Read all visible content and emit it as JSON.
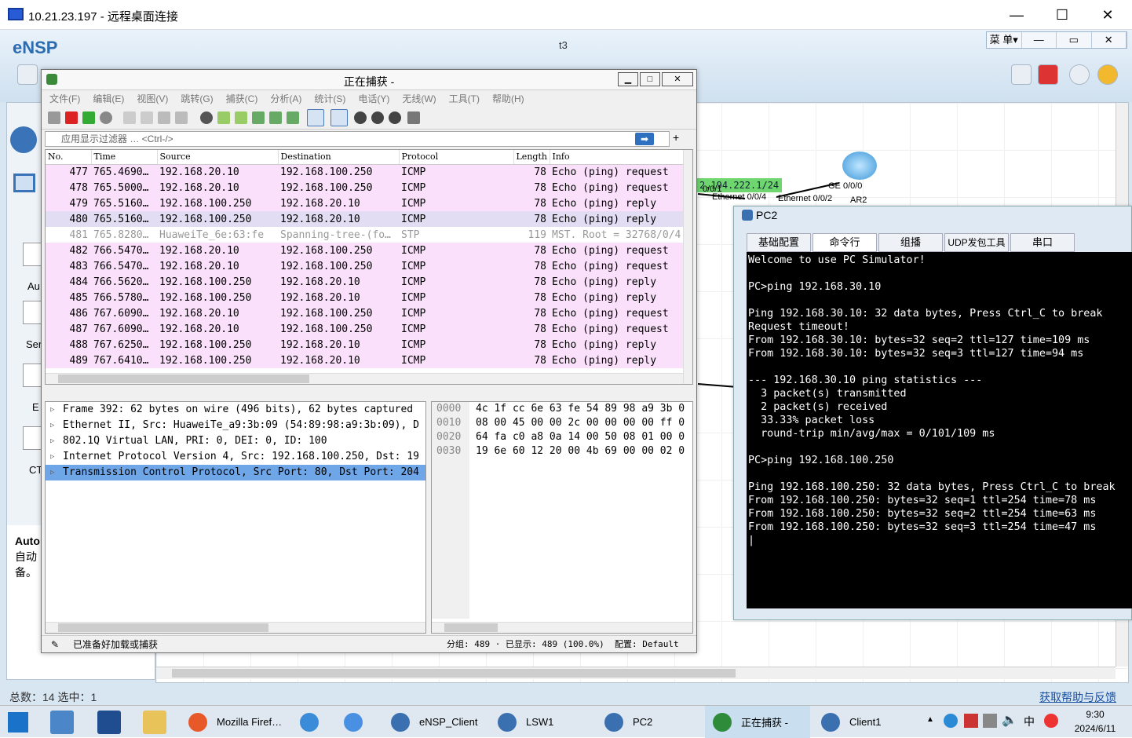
{
  "rdp": {
    "title": "10.21.23.197 - 远程桌面连接",
    "minimize": "—",
    "maximize": "☐",
    "close": "✕"
  },
  "ensp": {
    "logo": "eNSP",
    "title": "t3",
    "menu": [
      "菜 单▾",
      "—",
      "▭",
      "✕"
    ],
    "left_labels": [
      "Au",
      "Ser",
      "E",
      "CT"
    ],
    "auto_title": "Auto",
    "auto_desc": "自动 备。",
    "status_left": "总数：14  选中：1",
    "status_right": "获取帮助与反馈",
    "canvas_labels": {
      "ip": "2.194.222.1/24",
      "eth041": "Ethernet 0/0/4",
      "eth01": "0/0/1",
      "eth02": "Ethernet 0/0/2",
      "ge": "GE 0/0/0",
      "ar2": "AR2"
    }
  },
  "wireshark": {
    "title": "正在捕获 -",
    "menu": [
      "文件(F)",
      "编辑(E)",
      "视图(V)",
      "跳转(G)",
      "捕获(C)",
      "分析(A)",
      "统计(S)",
      "电话(Y)",
      "无线(W)",
      "工具(T)",
      "帮助(H)"
    ],
    "filter_placeholder": "应用显示过滤器 … <Ctrl-/>",
    "columns": [
      "No.",
      "Time",
      "Source",
      "Destination",
      "Protocol",
      "Length",
      "Info"
    ],
    "packets": [
      {
        "no": "477",
        "time": "765.4690…",
        "src": "192.168.20.10",
        "dst": "192.168.100.250",
        "proto": "ICMP",
        "len": "78",
        "info": "Echo (ping) request",
        "cls": "icmp"
      },
      {
        "no": "478",
        "time": "765.5000…",
        "src": "192.168.20.10",
        "dst": "192.168.100.250",
        "proto": "ICMP",
        "len": "78",
        "info": "Echo (ping) request",
        "cls": "icmp"
      },
      {
        "no": "479",
        "time": "765.5160…",
        "src": "192.168.100.250",
        "dst": "192.168.20.10",
        "proto": "ICMP",
        "len": "78",
        "info": "Echo (ping) reply",
        "cls": "icmp"
      },
      {
        "no": "480",
        "time": "765.5160…",
        "src": "192.168.100.250",
        "dst": "192.168.20.10",
        "proto": "ICMP",
        "len": "78",
        "info": "Echo (ping) reply",
        "cls": "sel"
      },
      {
        "no": "481",
        "time": "765.8280…",
        "src": "HuaweiTe_6e:63:fe",
        "dst": "Spanning-tree-(fo…",
        "proto": "STP",
        "len": "119",
        "info": "MST. Root = 32768/0/4",
        "cls": "stp"
      },
      {
        "no": "482",
        "time": "766.5470…",
        "src": "192.168.20.10",
        "dst": "192.168.100.250",
        "proto": "ICMP",
        "len": "78",
        "info": "Echo (ping) request",
        "cls": "icmp"
      },
      {
        "no": "483",
        "time": "766.5470…",
        "src": "192.168.20.10",
        "dst": "192.168.100.250",
        "proto": "ICMP",
        "len": "78",
        "info": "Echo (ping) request",
        "cls": "icmp"
      },
      {
        "no": "484",
        "time": "766.5620…",
        "src": "192.168.100.250",
        "dst": "192.168.20.10",
        "proto": "ICMP",
        "len": "78",
        "info": "Echo (ping) reply",
        "cls": "icmp"
      },
      {
        "no": "485",
        "time": "766.5780…",
        "src": "192.168.100.250",
        "dst": "192.168.20.10",
        "proto": "ICMP",
        "len": "78",
        "info": "Echo (ping) reply",
        "cls": "icmp"
      },
      {
        "no": "486",
        "time": "767.6090…",
        "src": "192.168.20.10",
        "dst": "192.168.100.250",
        "proto": "ICMP",
        "len": "78",
        "info": "Echo (ping) request",
        "cls": "icmp"
      },
      {
        "no": "487",
        "time": "767.6090…",
        "src": "192.168.20.10",
        "dst": "192.168.100.250",
        "proto": "ICMP",
        "len": "78",
        "info": "Echo (ping) request",
        "cls": "icmp"
      },
      {
        "no": "488",
        "time": "767.6250…",
        "src": "192.168.100.250",
        "dst": "192.168.20.10",
        "proto": "ICMP",
        "len": "78",
        "info": "Echo (ping) reply",
        "cls": "icmp"
      },
      {
        "no": "489",
        "time": "767.6410…",
        "src": "192.168.100.250",
        "dst": "192.168.20.10",
        "proto": "ICMP",
        "len": "78",
        "info": "Echo (ping) reply",
        "cls": "icmp"
      }
    ],
    "details": [
      "Frame 392: 62 bytes on wire (496 bits), 62 bytes captured",
      "Ethernet II, Src: HuaweiTe_a9:3b:09 (54:89:98:a9:3b:09), D",
      "802.1Q Virtual LAN, PRI: 0, DEI: 0, ID: 100",
      "Internet Protocol Version 4, Src: 192.168.100.250, Dst: 19",
      "Transmission Control Protocol, Src Port: 80, Dst Port: 204"
    ],
    "bytes": [
      {
        "off": "0000",
        "hex": "4c 1f cc 6e 63 fe 54 89  98 a9 3b 0"
      },
      {
        "off": "0010",
        "hex": "08 00 45 00 00 2c 00 00  00 00 ff 0"
      },
      {
        "off": "0020",
        "hex": "64 fa c0 a8 0a 14 00 50  08 01 00 0"
      },
      {
        "off": "0030",
        "hex": "19 6e 60 12 20 00 4b 69  00 00 02 0"
      }
    ],
    "status_ready": "已准备好加载或捕获",
    "status_packets": "分组: 489 · 已显示: 489 (100.0%)",
    "status_profile": "配置: Default"
  },
  "pc2": {
    "title": "PC2",
    "tabs": [
      "基础配置",
      "命令行",
      "组播",
      "UDP发包工具",
      "串口"
    ],
    "terminal": "Welcome to use PC Simulator!\n\nPC>ping 192.168.30.10\n\nPing 192.168.30.10: 32 data bytes, Press Ctrl_C to break\nRequest timeout!\nFrom 192.168.30.10: bytes=32 seq=2 ttl=127 time=109 ms\nFrom 192.168.30.10: bytes=32 seq=3 ttl=127 time=94 ms\n\n--- 192.168.30.10 ping statistics ---\n  3 packet(s) transmitted\n  2 packet(s) received\n  33.33% packet loss\n  round-trip min/avg/max = 0/101/109 ms\n\nPC>ping 192.168.100.250\n\nPing 192.168.100.250: 32 data bytes, Press Ctrl_C to break\nFrom 192.168.100.250: bytes=32 seq=1 ttl=254 time=78 ms\nFrom 192.168.100.250: bytes=32 seq=2 ttl=254 time=63 ms\nFrom 192.168.100.250: bytes=32 seq=3 ttl=254 time=47 ms\n|"
  },
  "taskbar": {
    "items": [
      {
        "label": "Mozilla Firef…",
        "color": "#e8592a"
      },
      {
        "label": "",
        "color": "#3a8bd8"
      },
      {
        "label": "",
        "color": "#4a90e2"
      },
      {
        "label": "eNSP_Client",
        "color": "#3a6fb0"
      },
      {
        "label": "LSW1",
        "color": "#3a6fb0"
      },
      {
        "label": "PC2",
        "color": "#3a6fb0"
      },
      {
        "label": "正在捕获 -",
        "color": "#2e8b3a"
      },
      {
        "label": "Client1",
        "color": "#3a6fb0"
      }
    ],
    "time": "9:30",
    "date": "2024/6/11",
    "ime": "中"
  }
}
